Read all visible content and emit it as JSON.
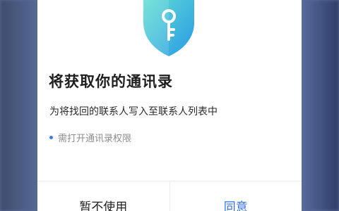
{
  "dialog": {
    "icon": "key-shield-icon",
    "title": "将获取你的通讯录",
    "description": "为将找回的联系人写入至联系人列表中",
    "permission_note": "需打开通讯录权限",
    "buttons": {
      "deny_label": "暂不使用",
      "allow_label": "同意"
    }
  },
  "colors": {
    "accent": "#2f6fe0",
    "shield_top": "#5fe0cf",
    "shield_bottom": "#2a9ee6",
    "title_text": "#1e1e1e",
    "note_text": "#8c8c8c"
  }
}
